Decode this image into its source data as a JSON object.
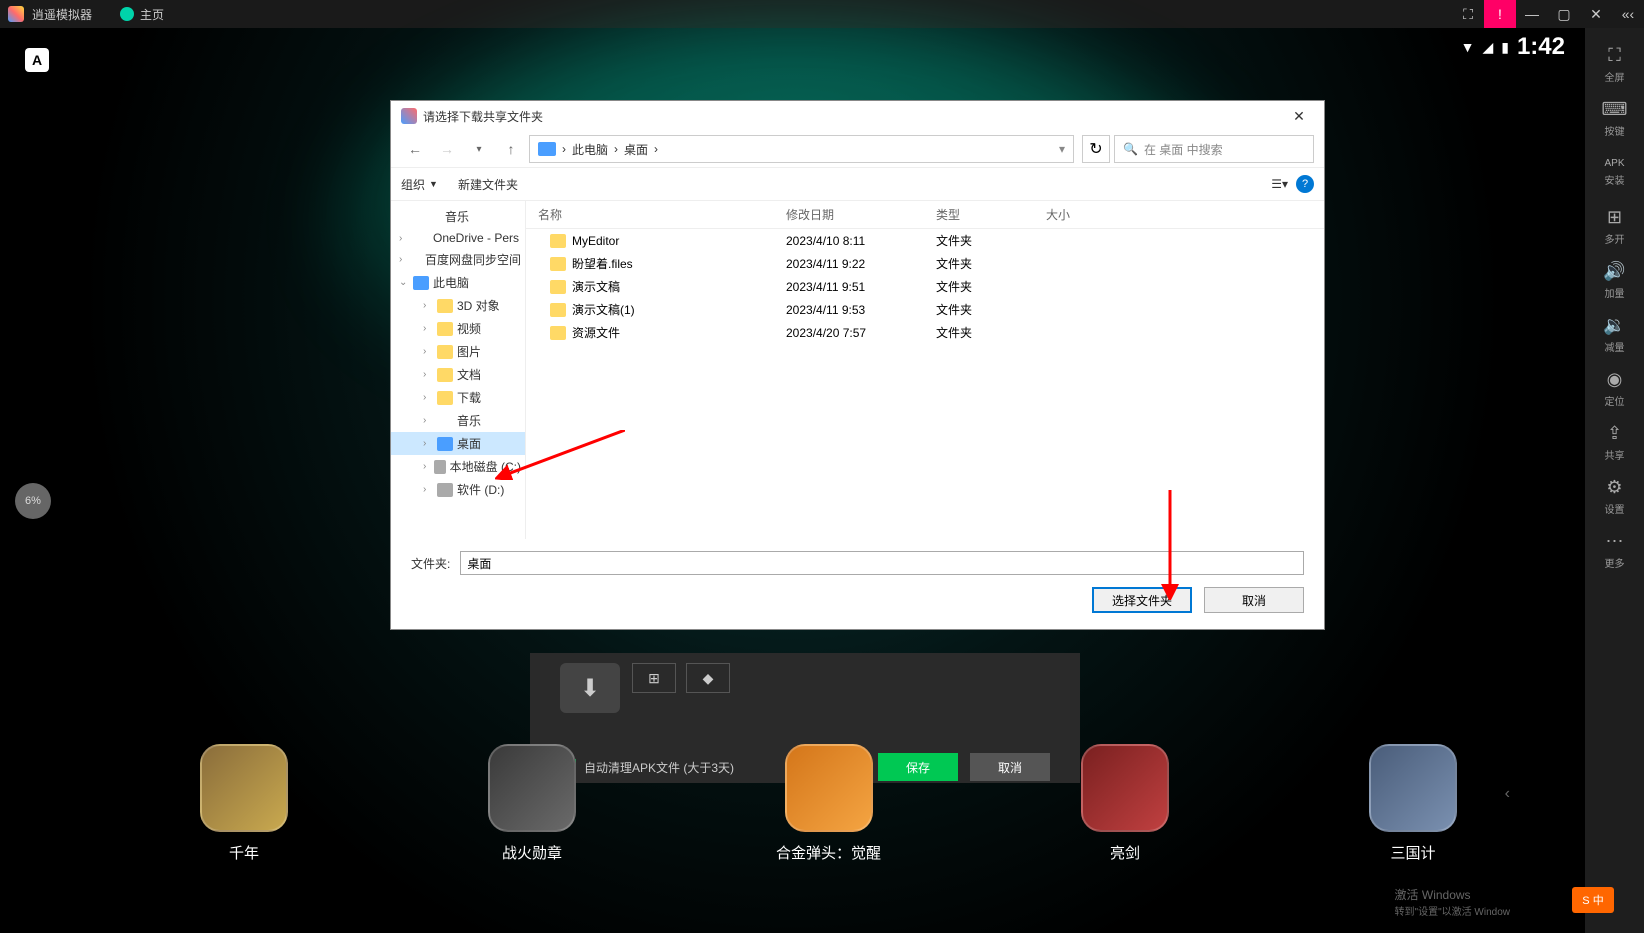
{
  "titlebar": {
    "app_name": "逍遥模拟器",
    "tab_label": "主页"
  },
  "status_bar": {
    "time": "1:42"
  },
  "progress": "6%",
  "sidebar": {
    "items": [
      {
        "icon": "⛶",
        "label": "全屏"
      },
      {
        "icon": "⌨",
        "label": "按键"
      },
      {
        "icon": "APK",
        "label": "安装"
      },
      {
        "icon": "⊞",
        "label": "多开"
      },
      {
        "icon": "🔊",
        "label": "加量"
      },
      {
        "icon": "🔉",
        "label": "减量"
      },
      {
        "icon": "📍",
        "label": "定位"
      },
      {
        "icon": "⇪",
        "label": "共享"
      },
      {
        "icon": "⚙",
        "label": "设置"
      },
      {
        "icon": "⋯",
        "label": "更多"
      }
    ]
  },
  "dialog": {
    "title": "请选择下载共享文件夹",
    "breadcrumb": [
      "此电脑",
      "桌面"
    ],
    "search_placeholder": "在 桌面 中搜索",
    "toolbar": {
      "organize": "组织",
      "new_folder": "新建文件夹"
    },
    "tree": [
      {
        "label": "音乐",
        "icon_type": "music",
        "level": 2
      },
      {
        "label": "OneDrive - Pers",
        "icon_type": "cloud",
        "level": 1,
        "chevron": ">"
      },
      {
        "label": "百度网盘同步空间",
        "icon_type": "cloud",
        "level": 1,
        "chevron": ">"
      },
      {
        "label": "此电脑",
        "icon_type": "pc",
        "level": 1,
        "chevron": "v"
      },
      {
        "label": "3D 对象",
        "icon_type": "folder",
        "level": 3,
        "chevron": ">"
      },
      {
        "label": "视频",
        "icon_type": "folder",
        "level": 3,
        "chevron": ">"
      },
      {
        "label": "图片",
        "icon_type": "folder",
        "level": 3,
        "chevron": ">"
      },
      {
        "label": "文档",
        "icon_type": "folder",
        "level": 3,
        "chevron": ">"
      },
      {
        "label": "下载",
        "icon_type": "folder",
        "level": 3,
        "chevron": ">"
      },
      {
        "label": "音乐",
        "icon_type": "music",
        "level": 3,
        "chevron": ">"
      },
      {
        "label": "桌面",
        "icon_type": "pc",
        "level": 3,
        "chevron": ">",
        "selected": true
      },
      {
        "label": "本地磁盘 (C:)",
        "icon_type": "drive",
        "level": 3,
        "chevron": ">"
      },
      {
        "label": "软件 (D:)",
        "icon_type": "drive",
        "level": 3,
        "chevron": ">"
      }
    ],
    "columns": {
      "name": "名称",
      "date": "修改日期",
      "type": "类型",
      "size": "大小"
    },
    "files": [
      {
        "name": "MyEditor",
        "date": "2023/4/10 8:11",
        "type": "文件夹"
      },
      {
        "name": "盼望着.files",
        "date": "2023/4/11 9:22",
        "type": "文件夹"
      },
      {
        "name": "演示文稿",
        "date": "2023/4/11 9:51",
        "type": "文件夹"
      },
      {
        "name": "演示文稿(1)",
        "date": "2023/4/11 9:53",
        "type": "文件夹"
      },
      {
        "name": "资源文件",
        "date": "2023/4/20 7:57",
        "type": "文件夹"
      }
    ],
    "footer": {
      "label": "文件夹:",
      "value": "桌面",
      "select_btn": "选择文件夹",
      "cancel_btn": "取消"
    }
  },
  "dark_panel": {
    "checkbox_label": "自动清理APK文件 (大于3天)",
    "save_btn": "保存",
    "cancel_btn": "取消"
  },
  "games": [
    {
      "name": "千年"
    },
    {
      "name": "战火勋章"
    },
    {
      "name": "合金弹头：觉醒"
    },
    {
      "name": "亮剑"
    },
    {
      "name": "三国计"
    }
  ],
  "watermark": {
    "line1": "激活 Windows",
    "line2": "转到\"设置\"以激活 Window"
  },
  "ime": "S 中"
}
